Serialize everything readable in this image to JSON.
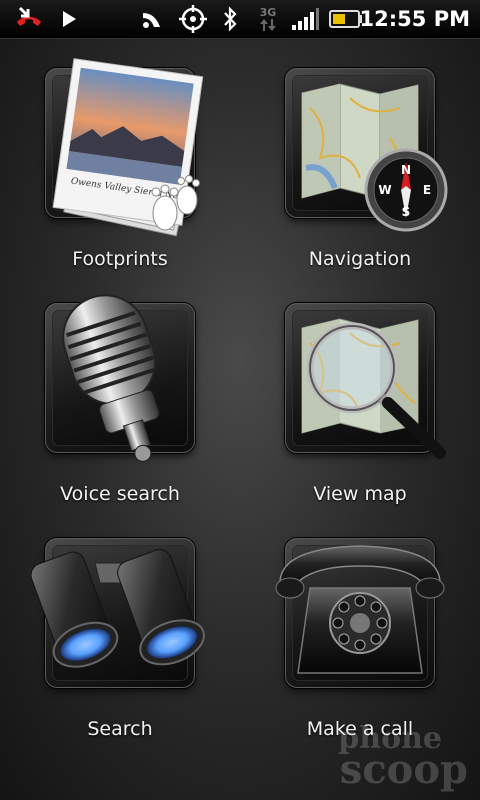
{
  "status_bar": {
    "time": "12:55 PM",
    "icons": [
      "missed-call-icon",
      "play-icon",
      "wifi-icon",
      "gps-icon",
      "bluetooth-icon",
      "3g-data-icon",
      "signal-strength-icon",
      "battery-icon"
    ],
    "network_label": "3G"
  },
  "tiles": [
    {
      "label": "Footprints",
      "icon": "footprints-icon",
      "photo_caption": "Owens Valley Sierra Nevada"
    },
    {
      "label": "Navigation",
      "icon": "navigation-icon",
      "compass": {
        "n": "N",
        "s": "S",
        "e": "E",
        "w": "W"
      }
    },
    {
      "label": "Voice search",
      "icon": "microphone-icon"
    },
    {
      "label": "View map",
      "icon": "magnifier-map-icon"
    },
    {
      "label": "Search",
      "icon": "binoculars-icon"
    },
    {
      "label": "Make a call",
      "icon": "telephone-icon"
    }
  ],
  "watermark": {
    "line1": "phone",
    "line2": "scoop"
  },
  "colors": {
    "battery_fill": "#e8c100",
    "lens_blue": "#5aa0ff",
    "compass_red": "#d81e1e"
  }
}
